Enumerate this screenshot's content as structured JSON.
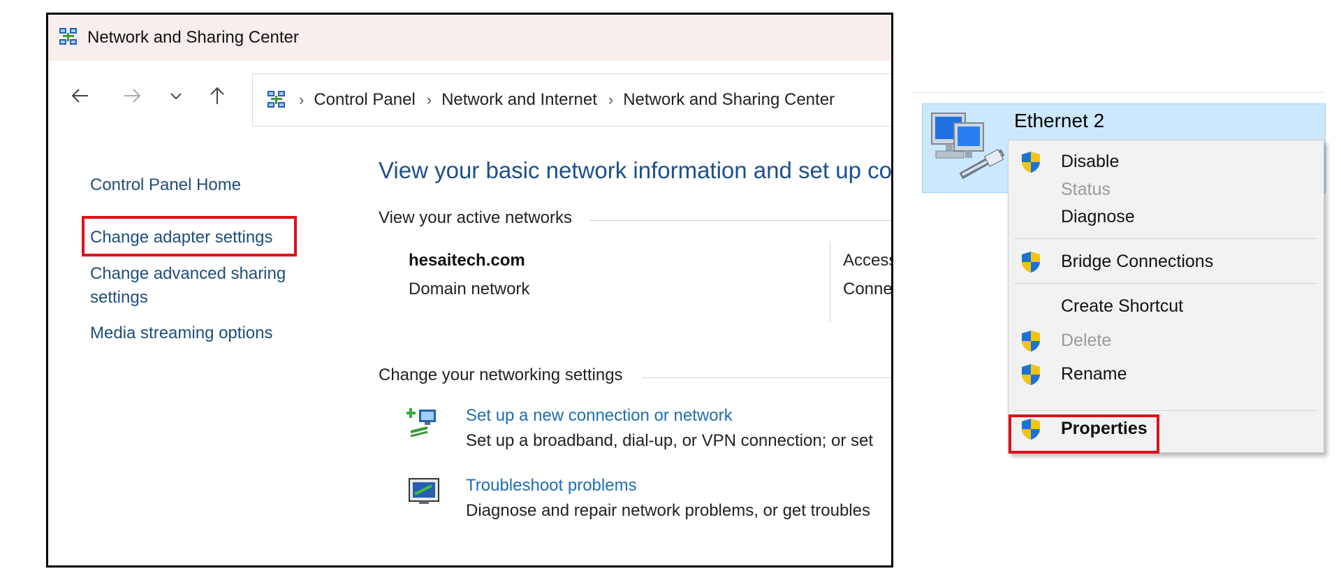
{
  "window": {
    "title": "Network and Sharing Center",
    "breadcrumb": [
      "Control Panel",
      "Network and Internet",
      "Network and Sharing Center"
    ]
  },
  "sidebar": {
    "home": "Control Panel Home",
    "change_adapter": "Change adapter settings",
    "advanced_sharing_line1": "Change advanced sharing",
    "advanced_sharing_line2": "settings",
    "media_streaming": "Media streaming options"
  },
  "main": {
    "heading": "View your basic network information and set up co",
    "active_networks_label": "View your active networks",
    "network": {
      "name": "hesaitech.com",
      "type": "Domain network",
      "access_label": "Access",
      "connections_label": "Conne"
    },
    "change_settings_label": "Change your networking settings",
    "tasks": [
      {
        "link": "Set up a new connection or network",
        "description": "Set up a broadband, dial-up, or VPN connection; or set"
      },
      {
        "link": "Troubleshoot problems",
        "description": "Diagnose and repair network problems, or get troubles"
      }
    ]
  },
  "adapter": {
    "name": "Ethernet 2"
  },
  "context_menu": {
    "items": [
      {
        "label": "Disable",
        "shield": true,
        "enabled": true
      },
      {
        "label": "Status",
        "shield": false,
        "enabled": false
      },
      {
        "label": "Diagnose",
        "shield": false,
        "enabled": true
      },
      {
        "label": "Bridge Connections",
        "shield": true,
        "enabled": true
      },
      {
        "label": "Create Shortcut",
        "shield": false,
        "enabled": true
      },
      {
        "label": "Delete",
        "shield": true,
        "enabled": false
      },
      {
        "label": "Rename",
        "shield": true,
        "enabled": true
      },
      {
        "label": "Properties",
        "shield": true,
        "enabled": true,
        "bold": true,
        "highlighted": true
      }
    ]
  },
  "colors": {
    "highlight": "#e0101a",
    "link": "#1f4e79",
    "heading": "#1c4f8c",
    "selection": "#cce8ff"
  }
}
